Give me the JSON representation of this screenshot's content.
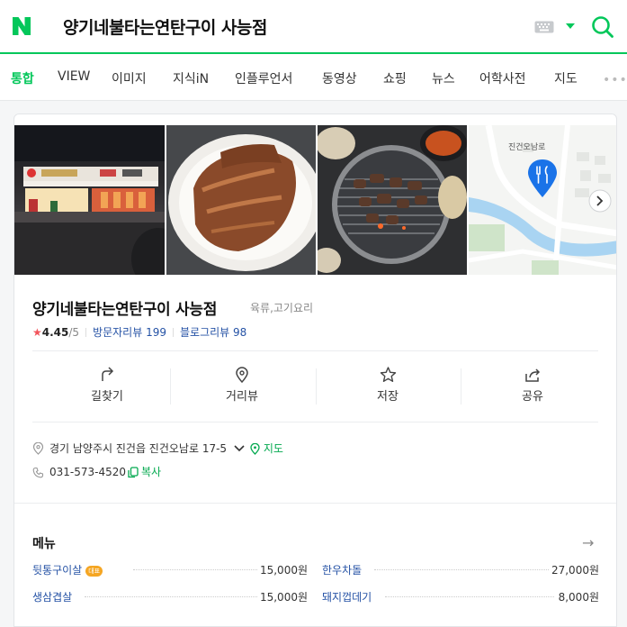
{
  "search": {
    "query": "양기네불타는연탄구이 사능점"
  },
  "tabs": [
    "통합",
    "VIEW",
    "이미지",
    "지식iN",
    "인플루언서",
    "동영상",
    "쇼핑",
    "뉴스",
    "어학사전",
    "지도"
  ],
  "active_tab": "통합",
  "place": {
    "photos": [
      "storefront-photo",
      "marinated-meat-photo",
      "grill-photo",
      "map-thumbnail"
    ],
    "map_label": "진건오남로",
    "name": "양기네불타는연탄구이 사능점",
    "category": "육류,고기요리",
    "rating": "4.45",
    "rating_max": "/5",
    "visitor_reviews_label": "방문자리뷰",
    "visitor_reviews_count": "199",
    "blog_reviews_label": "블로그리뷰",
    "blog_reviews_count": "98"
  },
  "actions": [
    "길찾기",
    "거리뷰",
    "저장",
    "공유"
  ],
  "info": {
    "address": "경기 남양주시 진건읍 진건오남로 17-5",
    "map_link": "지도",
    "phone": "031-573-4520",
    "copy_link": "복사"
  },
  "menu": {
    "heading": "메뉴",
    "items": [
      {
        "name": "뒷통구이살",
        "badge": "대표",
        "price": "15,000원"
      },
      {
        "name": "한우차돌",
        "price": "27,000원"
      },
      {
        "name": "생삼겹살",
        "price": "15,000원"
      },
      {
        "name": "돼지껍데기",
        "price": "8,000원"
      }
    ]
  },
  "colors": {
    "brand_green": "#03c75a",
    "link_blue": "#2552a5",
    "star_red": "#f2545b"
  }
}
